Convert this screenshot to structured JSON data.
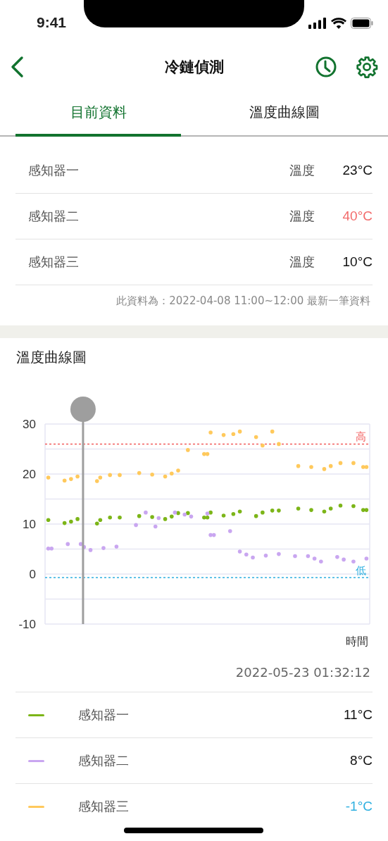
{
  "status_bar": {
    "time": "9:41"
  },
  "header": {
    "title": "冷鏈偵測"
  },
  "tabs": [
    {
      "label": "目前資料",
      "selected": true
    },
    {
      "label": "溫度曲線圖",
      "selected": false
    }
  ],
  "sensors": [
    {
      "name": "感知器一",
      "label": "溫度",
      "value": "23°C",
      "high": false,
      "low": false
    },
    {
      "name": "感知器二",
      "label": "溫度",
      "value": "40°C",
      "high": true,
      "low": false
    },
    {
      "name": "感知器三",
      "label": "溫度",
      "value": "10°C",
      "high": false,
      "low": false
    }
  ],
  "data_note": "此資料為：2022-04-08 11:00~12:00 最新一筆資料",
  "chart_section": {
    "title": "溫度曲線圖",
    "y_axis_labels": [
      "30",
      "20",
      "10",
      "0",
      "-10"
    ],
    "x_axis_title": "時間",
    "high_label": "高",
    "low_label": "低"
  },
  "cursor_time": "2022-05-23 01:32:12",
  "readings": [
    {
      "name": "感知器一",
      "color": "#7cb518",
      "value": "11°C",
      "high": false,
      "low": false
    },
    {
      "name": "感知器二",
      "color": "#c9a6f0",
      "value": "8°C",
      "high": false,
      "low": false
    },
    {
      "name": "感知器三",
      "color": "#ffc95c",
      "value": "-1°C",
      "high": false,
      "low": true
    }
  ]
}
